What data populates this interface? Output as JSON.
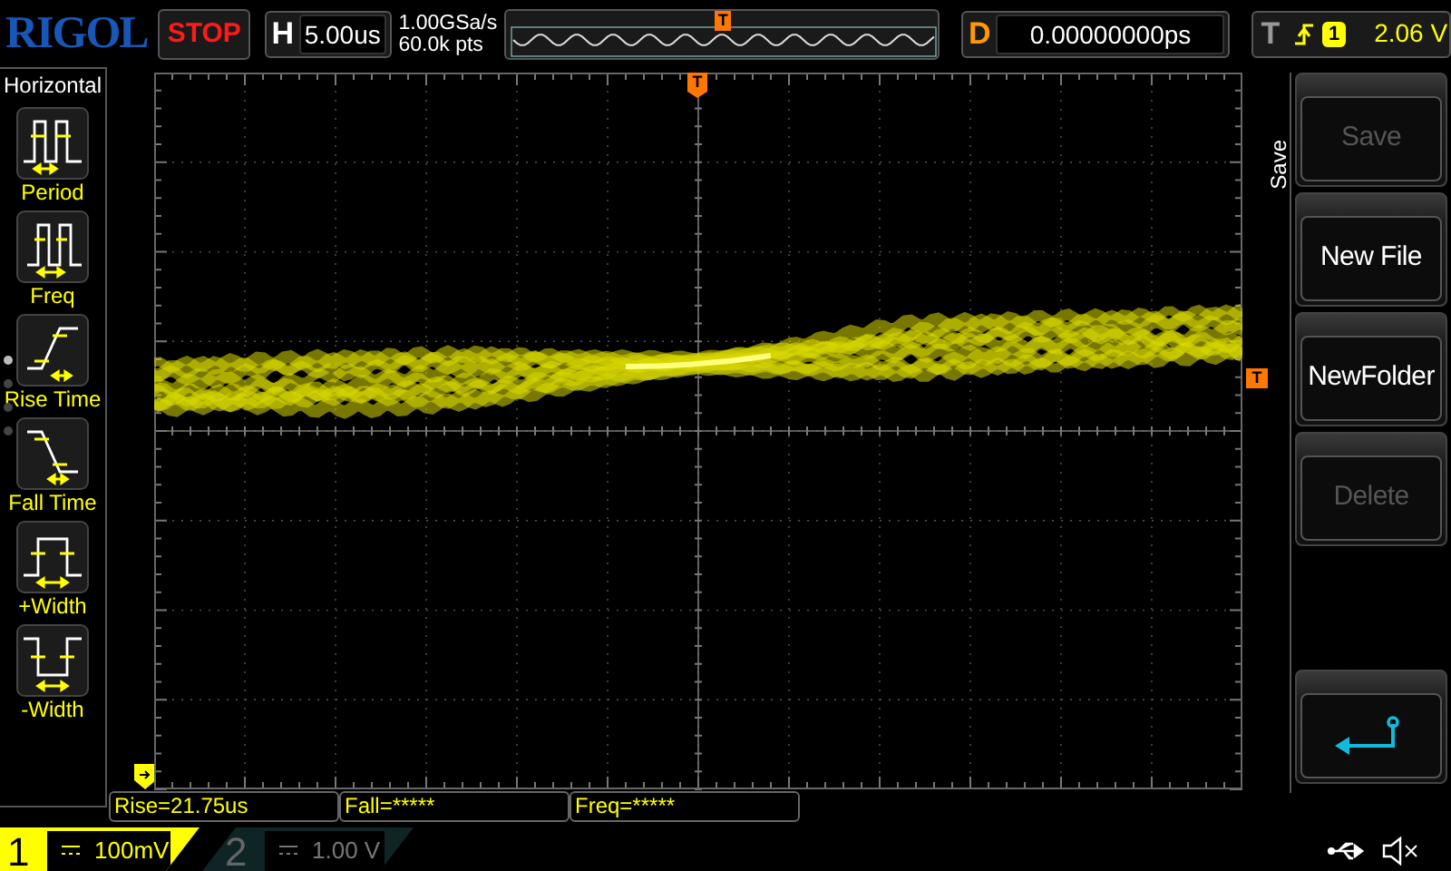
{
  "brand": {
    "logo": "RIGOL"
  },
  "run_state": {
    "label": "STOP"
  },
  "timebase": {
    "letter": "H",
    "value": "5.00us"
  },
  "sample": {
    "rate": "1.00GSa/s",
    "depth": "60.0k pts"
  },
  "memory_strip": {
    "marker": "T"
  },
  "delay": {
    "letter": "D",
    "value": "0.00000000ps"
  },
  "trigger": {
    "letter": "T",
    "source": "1",
    "level": "2.06 V"
  },
  "left_menu": {
    "title": "Horizontal",
    "items": [
      {
        "label": "Period",
        "kind": "period"
      },
      {
        "label": "Freq",
        "kind": "freq"
      },
      {
        "label": "Rise Time",
        "kind": "rise"
      },
      {
        "label": "Fall Time",
        "kind": "fall"
      },
      {
        "label": "+Width",
        "kind": "pwidth"
      },
      {
        "label": "-Width",
        "kind": "nwidth"
      }
    ],
    "page_dots": [
      {
        "selected": true
      },
      {
        "selected": false
      },
      {
        "selected": false
      },
      {
        "selected": false
      }
    ]
  },
  "grid": {
    "trigger_position_marker": "T",
    "trigger_level_marker": "T"
  },
  "right_menu": {
    "title": "Save",
    "buttons": [
      {
        "kind": "text",
        "label": "Save",
        "disabled": true
      },
      {
        "kind": "text",
        "label": "New File",
        "disabled": false
      },
      {
        "kind": "text",
        "label": "NewFolder",
        "disabled": false
      },
      {
        "kind": "text",
        "label": "Delete",
        "disabled": true
      },
      {
        "kind": "return",
        "disabled": false
      }
    ]
  },
  "measurements": [
    {
      "text": "Rise=21.75us"
    },
    {
      "text": "Fall=*****"
    },
    {
      "text": "Freq=*****"
    }
  ],
  "channels": [
    {
      "number": "1",
      "scale": "100mV",
      "active": true
    },
    {
      "number": "2",
      "scale": "1.00 V",
      "active": false
    }
  ]
}
